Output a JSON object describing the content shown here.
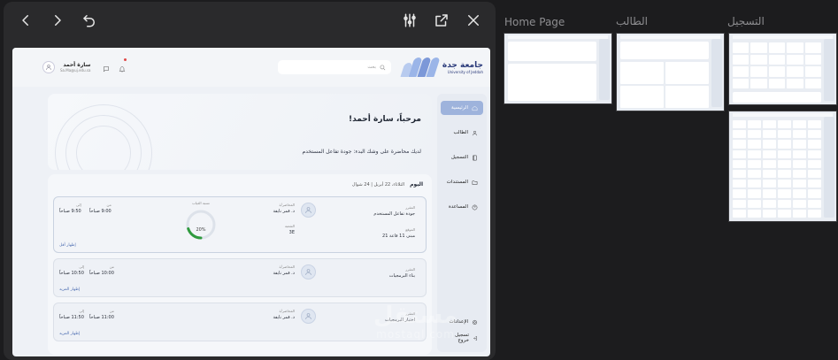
{
  "toolbar": {
    "icons": [
      "chevron-left-icon",
      "chevron-right-icon",
      "refresh-icon",
      "sliders-icon",
      "external-link-icon",
      "close-icon"
    ]
  },
  "design": {
    "logo": {
      "arabic": "جامعة جدة",
      "english": "University of Jeddah"
    },
    "search": {
      "placeholder": "بحث"
    },
    "user": {
      "name": "سارة أحمد",
      "email": "Sa.Ma@uj.edu.sa"
    },
    "sidebar": {
      "items": [
        {
          "label": "الرئيسية",
          "icon": "home-icon",
          "active": true
        },
        {
          "label": "الطالب",
          "icon": "user-icon"
        },
        {
          "label": "التسجيل",
          "icon": "book-icon"
        },
        {
          "label": "المستندات",
          "icon": "folder-icon"
        },
        {
          "label": "المساعدة",
          "icon": "help-icon"
        }
      ],
      "bottom": [
        {
          "label": "الإعدادات",
          "icon": "gear-icon"
        },
        {
          "label": "تسجيل خروج",
          "icon": "logout-icon"
        }
      ]
    },
    "welcome": {
      "title": "مرحباً، سارة أحمد!",
      "message": "لديك محاضرة على وشك البدء: جودة تفاعل المستخدم"
    },
    "schedule": {
      "today_label": "اليوم",
      "date_text": "الثلاثاء، 22 أبريل | 24 شوال",
      "lectures": [
        {
          "course_label": "المقرر",
          "course": "جودة تفاعل المستخدم",
          "lecturer_label": "المحاضر/ة",
          "lecturer": "د. قمر نايفة",
          "location_label": "الموقع",
          "location": "مبنى 11 قاعة 21",
          "capacity_label": "الشعبة",
          "capacity": "3E",
          "attendance_label": "نسبة الغياب",
          "attendance": "20%",
          "attendance_value": 0.2,
          "from_label": "من",
          "from": "9:00 صباحاً",
          "to_label": "إلى",
          "to": "9:50 صباحاً",
          "toggle": "إظهار أقل"
        },
        {
          "course_label": "المقرر",
          "course": "بناء البرمجيات",
          "lecturer_label": "المحاضر/ة",
          "lecturer": "د. قمر نايفة",
          "from_label": "من",
          "from": "10:00 صباحاً",
          "to_label": "إلى",
          "to": "10:50 صباحاً",
          "toggle": "إظهار المزيد"
        },
        {
          "course_label": "المقرر",
          "course": "اختبار البرمجيات",
          "lecturer_label": "المحاضر/ة",
          "lecturer": "د. قمر نايفة",
          "from_label": "من",
          "from": "11:00 صباحاً",
          "to_label": "إلى",
          "to": "11:50 صباحاً",
          "toggle": "إظهار المزيد"
        }
      ]
    }
  },
  "thumbnails": [
    {
      "label": "Home Page"
    },
    {
      "label": "الطالب"
    },
    {
      "label": "التسجيل"
    }
  ],
  "watermark": {
    "arabic": "مستقل",
    "english": "mostaql.com"
  }
}
